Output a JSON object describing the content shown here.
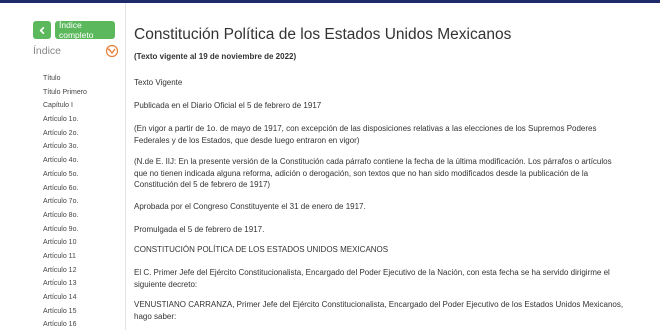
{
  "colors": {
    "accent": "#5cb85c",
    "topbar": "#1f2a6b",
    "index_icon": "#e8803a"
  },
  "sidebar": {
    "back_icon": "chevron-left-icon",
    "full_index_label": "Índice completo",
    "index_label": "Índice",
    "items": [
      "Título",
      "Título Primero",
      "Capítulo I",
      "Artículo 1o.",
      "Artículo 2o.",
      "Artículo 3o.",
      "Artículo 4o.",
      "Artículo 5o.",
      "Artículo 6o.",
      "Artículo 7o.",
      "Artículo 8o.",
      "Artículo 9o.",
      "Artículo 10",
      "Artículo 11",
      "Artículo 12",
      "Artículo 13",
      "Artículo 14",
      "Artículo 15",
      "Artículo 16"
    ]
  },
  "document": {
    "title": "Constitución Política de los Estados Unidos Mexicanos",
    "subtitle": "(Texto vigente al 19 de noviembre de 2022)",
    "paragraphs": [
      "Texto Vigente",
      "Publicada en el Diario Oficial el 5 de febrero de 1917",
      "(En vigor a partir de 1o. de mayo de 1917, con excepción de las disposiciones relativas a las elecciones de los Supremos Poderes Federales y de los Estados, que desde luego entraron en vigor)",
      "(N.de E. IIJ: En la presente versión de la Constitución cada párrafo contiene la fecha de la última modificación. Los párrafos o artículos que no tienen indicada alguna reforma, adición o derogación, son textos que no han sido modificados desde la publicación de la Constitución del 5 de febrero de 1917)",
      "Aprobada por el Congreso Constituyente el 31 de enero de 1917.",
      "Promulgada el 5 de febrero de 1917.",
      "CONSTITUCIÓN POLÍTICA DE LOS ESTADOS UNIDOS MEXICANOS",
      "El C. Primer Jefe del Ejército Constitucionalista, Encargado del Poder Ejecutivo de la Nación, con esta fecha se ha servido dirigirme el siguiente decreto:",
      "VENUSTIANO CARRANZA, Primer Jefe del Ejército Constitucionalista, Encargado del Poder Ejecutivo de los Estados Unidos Mexicanos, hago saber:"
    ]
  }
}
